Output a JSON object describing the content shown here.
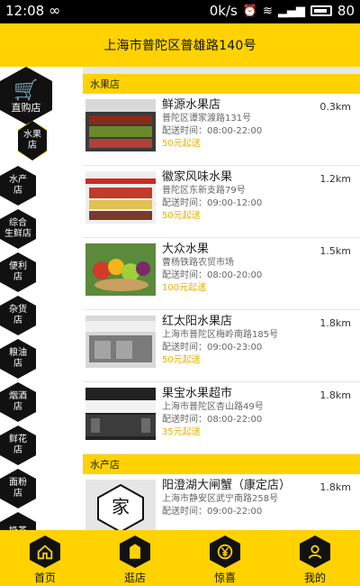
{
  "status_bar": {
    "time": "12:08",
    "net_speed": "0k/s",
    "battery": "80"
  },
  "header": {
    "title": "上海市普陀区普雄路140号"
  },
  "sidebar": {
    "home_label": "直购店",
    "active_item": "水果店",
    "items": [
      {
        "lines": [
          "水产",
          "店"
        ]
      },
      {
        "lines": [
          "综合",
          "生鲜店"
        ]
      },
      {
        "lines": [
          "便利",
          "店"
        ]
      },
      {
        "lines": [
          "杂货",
          "店"
        ]
      },
      {
        "lines": [
          "粮油",
          "店"
        ]
      },
      {
        "lines": [
          "烟酒",
          "店"
        ]
      },
      {
        "lines": [
          "鲜花",
          "店"
        ]
      },
      {
        "lines": [
          "面粉",
          "店"
        ]
      },
      {
        "lines": [
          "奶茶"
        ]
      }
    ]
  },
  "sections": [
    {
      "title": "水果店",
      "stores": [
        {
          "name": "鲜源水果店",
          "distance": "0.3km",
          "address": "普陀区谭家渡路131号",
          "hours": "配送时间：08:00-22:00",
          "min_order": "50元起送"
        },
        {
          "name": "徽家风味水果",
          "distance": "1.2km",
          "address": "普陀区东新支路79号",
          "hours": "配送时间：09:00-12:00",
          "min_order": "50元起送"
        },
        {
          "name": "大众水果",
          "distance": "1.5km",
          "address": "曹杨铁路农贸市场",
          "hours": "配送时间：08:00-20:00",
          "min_order": "100元起送"
        },
        {
          "name": "红太阳水果店",
          "distance": "1.8km",
          "address": "上海市普陀区梅岭南路185号",
          "hours": "配送时间：09:00-23:00",
          "min_order": "50元起送"
        },
        {
          "name": "果宝水果超市",
          "distance": "1.8km",
          "address": "上海市普陀区杏山路49号",
          "hours": "配送时间：08:00-22:00",
          "min_order": "35元起送"
        }
      ]
    },
    {
      "title": "水产店",
      "stores": [
        {
          "name": "阳澄湖大闸蟹（康定店）",
          "distance": "1.8km",
          "address": "上海市静安区武宁南路258号",
          "hours": "配送时间：09:00-22:00",
          "min_order": "",
          "logo_char": "家"
        }
      ]
    }
  ],
  "bottom_nav": [
    {
      "label": "首页",
      "icon": "home-icon"
    },
    {
      "label": "逛店",
      "icon": "shop-icon"
    },
    {
      "label": "惊喜",
      "icon": "yen-icon"
    },
    {
      "label": "我的",
      "icon": "user-icon"
    }
  ],
  "colors": {
    "accent": "#FFD200",
    "dark": "#111111",
    "min_order": "#E6B200"
  }
}
